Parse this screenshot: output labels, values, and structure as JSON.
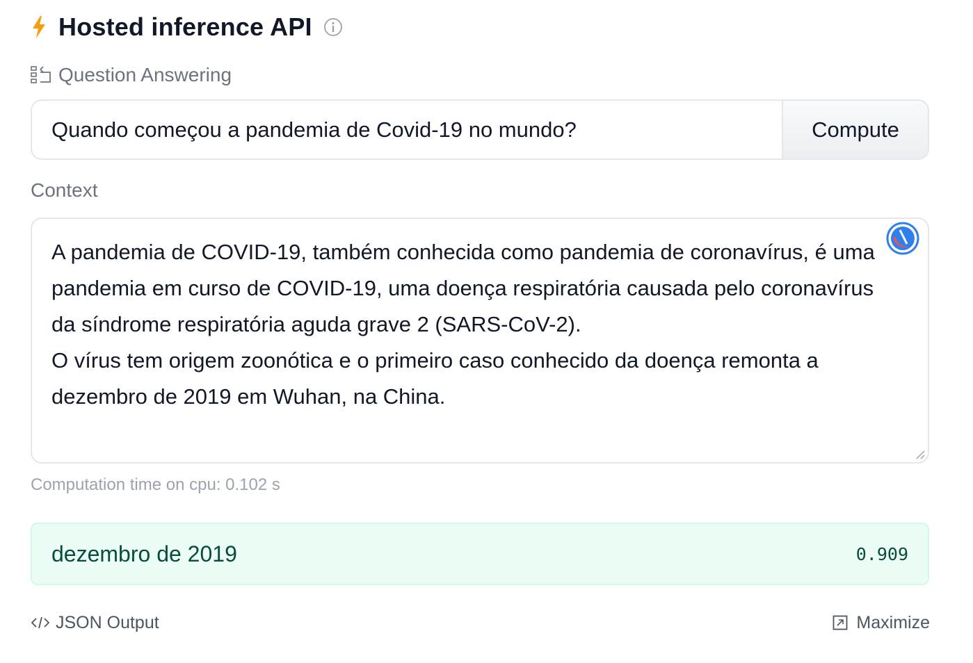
{
  "header": {
    "title": "Hosted inference API",
    "icon": "lightning-bolt-icon",
    "info_icon": "info-icon",
    "accent_color": "#f59e0b"
  },
  "task": {
    "label": "Question Answering",
    "icon": "question-answering-icon"
  },
  "question": {
    "value": "Quando começou a pandemia de Covid-19 no mundo?",
    "compute_label": "Compute"
  },
  "context": {
    "label": "Context",
    "value": "A pandemia de COVID-19, também conhecida como pandemia de coronavírus, é uma pandemia em curso de COVID-19, uma doença respiratória causada pelo coronavírus da síndrome respiratória aguda grave 2 (SARS-CoV-2).\nO vírus tem origem zoonótica e o primeiro caso conhecido da doença remonta a dezembro de 2019 em Wuhan, na China.",
    "extension_icon": "grammarly-icon"
  },
  "computation_time": "Computation time on cpu: 0.102 s",
  "answer": {
    "text": "dezembro de 2019",
    "score": "0.909",
    "background_color": "#ecfdf5"
  },
  "footer": {
    "json_output_label": "JSON Output",
    "json_output_icon": "code-icon",
    "maximize_label": "Maximize",
    "maximize_icon": "maximize-icon"
  }
}
